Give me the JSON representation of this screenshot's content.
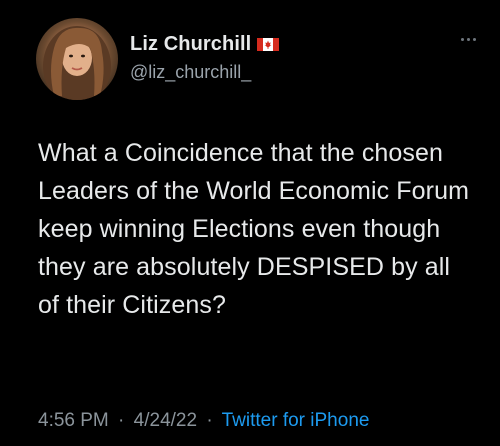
{
  "author": {
    "display_name": "Liz Churchill",
    "flag_icon": "canada-flag-icon",
    "handle": "@liz_churchill_"
  },
  "tweet": {
    "text": "What a Coincidence that the chosen Leaders of the World Economic Forum keep winning Elections even though they are absolutely DESPISED by all of their Citizens?"
  },
  "meta": {
    "time": "4:56 PM",
    "separator": "·",
    "date": "4/24/22",
    "source": "Twitter for iPhone"
  },
  "colors": {
    "background": "#000000",
    "text": "#e7e9ea",
    "secondary": "#8b949b",
    "link": "#1d9bf0"
  },
  "icons": {
    "more": "more-options-icon"
  }
}
